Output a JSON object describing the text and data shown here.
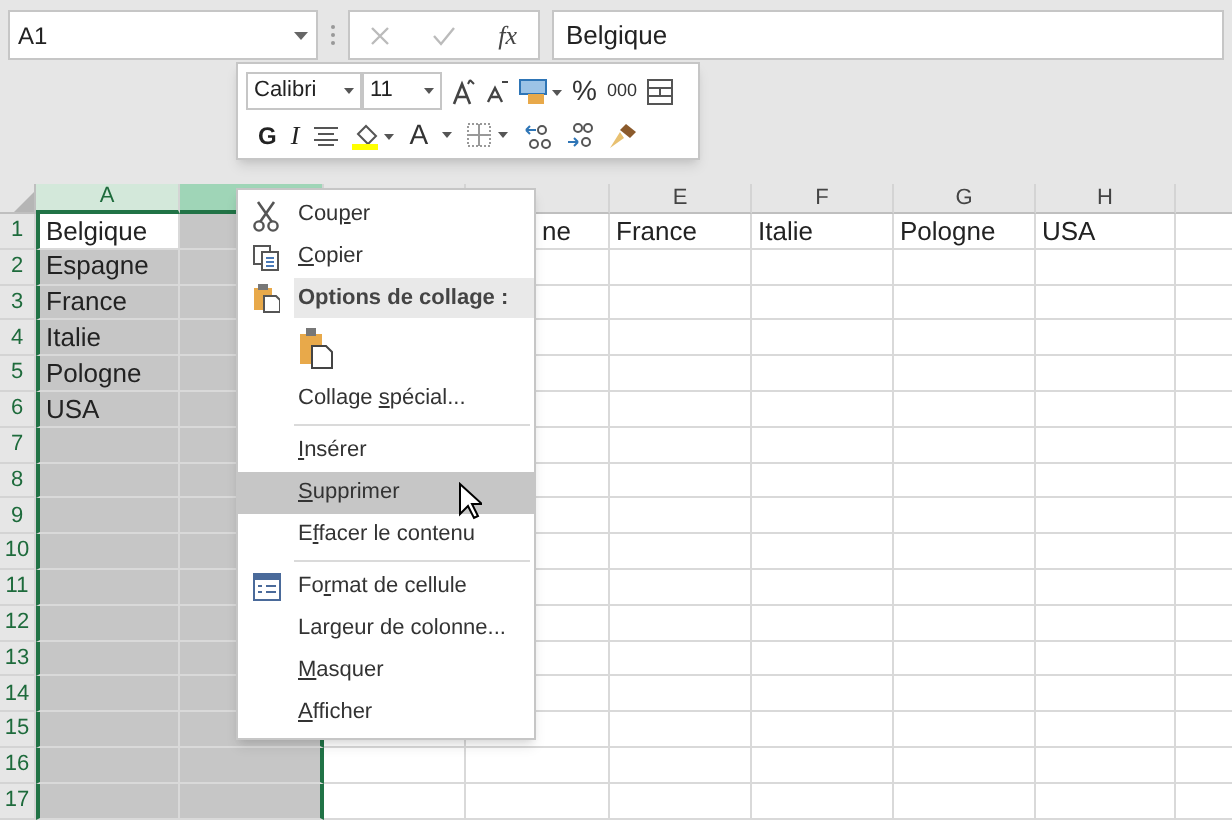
{
  "formula_bar": {
    "name_box": "A1",
    "function_label": "fx",
    "value": "Belgique"
  },
  "mini_toolbar": {
    "font": "Calibri",
    "size": "11",
    "percent": "%",
    "thousands": "000",
    "bold": "G",
    "italic": "I",
    "font_color": "A"
  },
  "columns": [
    {
      "header": "A",
      "selected": true
    },
    {
      "selected": true
    },
    {
      "selected": false
    },
    {
      "selected": false
    },
    {
      "header": "E",
      "selected": false
    },
    {
      "header": "F",
      "selected": false
    },
    {
      "header": "G",
      "selected": false
    },
    {
      "header": "H",
      "selected": false
    },
    {
      "selected": false
    }
  ],
  "rows": [
    {
      "number": "1",
      "cells": [
        {
          "text": "Belgique",
          "active": true
        },
        {},
        {},
        {
          "text": "ne"
        },
        {
          "text": "France"
        },
        {
          "text": "Italie"
        },
        {
          "text": "Pologne"
        },
        {
          "text": "USA"
        },
        {}
      ]
    },
    {
      "number": "2",
      "cells": [
        {
          "text": "Espagne"
        }
      ]
    },
    {
      "number": "3",
      "cells": [
        {
          "text": "France"
        }
      ]
    },
    {
      "number": "4",
      "cells": [
        {
          "text": "Italie"
        }
      ]
    },
    {
      "number": "5",
      "cells": [
        {
          "text": "Pologne"
        }
      ]
    },
    {
      "number": "6",
      "cells": [
        {
          "text": "USA"
        }
      ]
    },
    {
      "number": "7",
      "cells": []
    },
    {
      "number": "8",
      "cells": []
    },
    {
      "number": "9",
      "cells": []
    },
    {
      "number": "10",
      "cells": []
    },
    {
      "number": "11",
      "cells": []
    },
    {
      "number": "12",
      "cells": []
    },
    {
      "number": "13",
      "cells": []
    },
    {
      "number": "14",
      "cells": []
    },
    {
      "number": "15",
      "cells": []
    },
    {
      "number": "16",
      "cells": []
    },
    {
      "number": "17",
      "cells": []
    }
  ],
  "context_menu": [
    {
      "kind": "cut",
      "label": {
        "before": "Cou",
        "key": "p",
        "after": "er"
      },
      "selected": false
    },
    {
      "kind": "copy",
      "label": {
        "key": "C",
        "after": "opier"
      },
      "selected": false
    },
    {
      "kind": "header",
      "label": {
        "before": "Options de collage :"
      }
    },
    {
      "kind": "paste"
    },
    {
      "kind": "item",
      "label": {
        "before": "Collage ",
        "key": "s",
        "after": "pécial..."
      },
      "selected": false
    },
    {
      "kind": "separator"
    },
    {
      "kind": "item",
      "label": {
        "key": "I",
        "after": "nsérer"
      },
      "selected": false
    },
    {
      "kind": "item",
      "label": {
        "key": "S",
        "after": "upprimer"
      },
      "selected": true
    },
    {
      "kind": "item",
      "label": {
        "before": "E",
        "key": "f",
        "after": "facer le contenu"
      },
      "selected": false
    },
    {
      "kind": "separator"
    },
    {
      "kind": "format",
      "label": {
        "before": "Fo",
        "key": "r",
        "after": "mat de cellule"
      },
      "selected": false
    },
    {
      "kind": "item",
      "label": {
        "before": "Largeur de colonne..."
      },
      "selected": false
    },
    {
      "kind": "item",
      "label": {
        "key": "M",
        "after": "asquer"
      },
      "selected": false
    },
    {
      "kind": "item",
      "label": {
        "key": "A",
        "after": "fficher"
      },
      "selected": false
    }
  ]
}
